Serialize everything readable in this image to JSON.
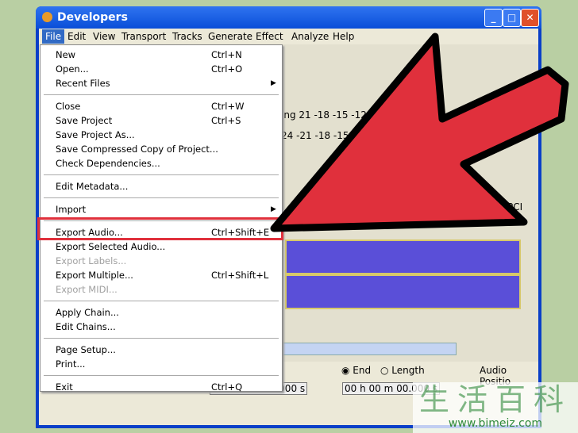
{
  "window": {
    "title": "Developers",
    "min": "_",
    "max": "□",
    "close": "✕"
  },
  "menubar": [
    "File",
    "Edit",
    "View",
    "Transport",
    "Tracks",
    "Generate",
    "Effect",
    "Analyze",
    "Help"
  ],
  "file_menu": [
    {
      "label": "New",
      "shortcut": "Ctrl+N"
    },
    {
      "label": "Open...",
      "shortcut": "Ctrl+O"
    },
    {
      "label": "Recent Files",
      "submenu": true
    },
    {
      "sep": true
    },
    {
      "label": "Close",
      "shortcut": "Ctrl+W"
    },
    {
      "label": "Save Project",
      "shortcut": "Ctrl+S"
    },
    {
      "label": "Save Project As..."
    },
    {
      "label": "Save Compressed Copy of Project..."
    },
    {
      "label": "Check Dependencies..."
    },
    {
      "sep": true
    },
    {
      "label": "Edit Metadata..."
    },
    {
      "sep": true
    },
    {
      "label": "Import",
      "submenu": true
    },
    {
      "sep": true
    },
    {
      "label": "Export Audio...",
      "shortcut": "Ctrl+Shift+E",
      "highlighted": true
    },
    {
      "label": "Export Selected Audio..."
    },
    {
      "label": "Export Labels...",
      "disabled": true
    },
    {
      "label": "Export Multiple...",
      "shortcut": "Ctrl+Shift+L"
    },
    {
      "label": "Export MIDI...",
      "disabled": true
    },
    {
      "sep": true
    },
    {
      "label": "Apply Chain..."
    },
    {
      "label": "Edit Chains..."
    },
    {
      "sep": true
    },
    {
      "label": "Page Setup..."
    },
    {
      "label": "Print..."
    },
    {
      "sep": true
    },
    {
      "label": "Exit",
      "shortcut": "Ctrl+Q"
    }
  ],
  "meters": {
    "row1": "ing 21 -18 -15 -12 -9",
    "row2": "24 -21 -18 -15 -1"
  },
  "device": "PCI",
  "selection": {
    "end_label": "End",
    "length_label": "Length",
    "audio_position": "Audio Positio",
    "time1": "00 h 00 m 00.000 s",
    "time2": "00 h 00 m 00.000 s"
  },
  "watermark": {
    "chars": "生活百科",
    "url": "www.bimeiz.com"
  },
  "colors": {
    "arrow": "#e0303c",
    "highlight_box": "#e0303c",
    "titlebar": "#0a4ed8"
  }
}
